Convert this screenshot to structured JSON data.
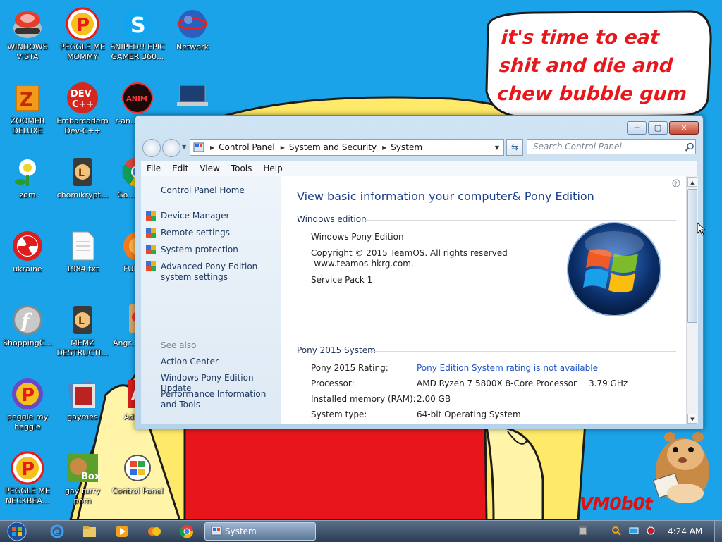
{
  "desktop": {
    "speech_bubble": "it's time to eat shit and die and chew bubble gum",
    "watermark": "VM0b0t",
    "icons": [
      {
        "label": "WINDOWS VISTA",
        "icon": "vista-game-icon"
      },
      {
        "label": "PEGGLE ME MOMMY",
        "icon": "peggle-icon"
      },
      {
        "label": "SNIPED!! EPIC GAMER 360...",
        "icon": "skype-icon"
      },
      {
        "label": "Network",
        "icon": "network-icon"
      },
      {
        "label": "ZOOMER DELUXE",
        "icon": "zoomer-icon"
      },
      {
        "label": "Embarcadero Dev-C++",
        "icon": "devcpp-icon"
      },
      {
        "label": "r-an... par...",
        "icon": "dark-app-icon"
      },
      {
        "label": "zom",
        "icon": "plant-icon"
      },
      {
        "label": "chomikrypt...",
        "icon": "hourglass-app-icon"
      },
      {
        "label": "Go... Chr...",
        "icon": "chrome-icon"
      },
      {
        "label": "ukraine",
        "icon": "radiation-icon"
      },
      {
        "label": "1984.txt",
        "icon": "text-file-icon"
      },
      {
        "label": "FURR...",
        "icon": "firefox-icon"
      },
      {
        "label": "ShoppingC...",
        "icon": "flash-icon"
      },
      {
        "label": "MEMZ DESTRUCTI...",
        "icon": "hourglass-app-icon"
      },
      {
        "label": "Angr... Sea...",
        "icon": "game-icon"
      },
      {
        "label": "peggle my heggle",
        "icon": "peggle-icon"
      },
      {
        "label": "gaymes",
        "icon": "folder-icon"
      },
      {
        "label": "Adob...",
        "icon": "adobe-icon"
      },
      {
        "label": "PEGGLE ME NECKBEA...",
        "icon": "peggle-icon"
      },
      {
        "label": "gay furry porn",
        "icon": "box-hamster-icon"
      },
      {
        "label": "Control Panel",
        "icon": "control-panel-icon"
      }
    ]
  },
  "window": {
    "breadcrumbs": [
      "Control Panel",
      "System and Security",
      "System"
    ],
    "search_placeholder": "Search Control Panel",
    "caption_buttons": {
      "minimize": "─",
      "restore": "▢",
      "close": "✕"
    },
    "menu": [
      "File",
      "Edit",
      "View",
      "Tools",
      "Help"
    ],
    "left_pane": {
      "home": "Control Panel Home",
      "tasks": [
        {
          "label": "Device Manager"
        },
        {
          "label": "Remote settings"
        },
        {
          "label": "System protection"
        },
        {
          "label": "Advanced Pony Edition system settings"
        }
      ],
      "see_also_heading": "See also",
      "see_also": [
        "Action Center",
        "Windows Pony Edition Update",
        "Performance Information and Tools"
      ]
    },
    "content": {
      "title": "View basic information your computer& Pony Edition",
      "windows_edition": {
        "heading": "Windows edition",
        "edition": "Windows Pony Edition",
        "copyright_line1": "Copyright © 2015 TeamOS.  All rights reserved",
        "copyright_line2": "-www.teamos-hkrg.com.",
        "service_pack": "Service Pack 1"
      },
      "system": {
        "heading": "Pony 2015 System",
        "rating_label": "Pony 2015 Rating:",
        "rating_value": "Pony Edition System rating is not available",
        "processor_label": "Processor:",
        "processor_value": "AMD Ryzen 7 5800X 8-Core Processor",
        "processor_speed": "3.79 GHz",
        "memory_label": "Installed memory (RAM):",
        "memory_value": "2.00 GB",
        "type_label": "System type:",
        "type_value": "64-bit Operating System"
      }
    }
  },
  "taskbar": {
    "active_window": "System",
    "clock": "4:24 AM",
    "pinned": [
      "ie-icon",
      "explorer-icon",
      "media-player-icon",
      "pinned-app-icon",
      "chrome-icon"
    ]
  },
  "colors": {
    "wallpaper_sky": "#1aa3e8",
    "link_blue": "#1e56c8",
    "title_blue": "#1b3f91"
  }
}
